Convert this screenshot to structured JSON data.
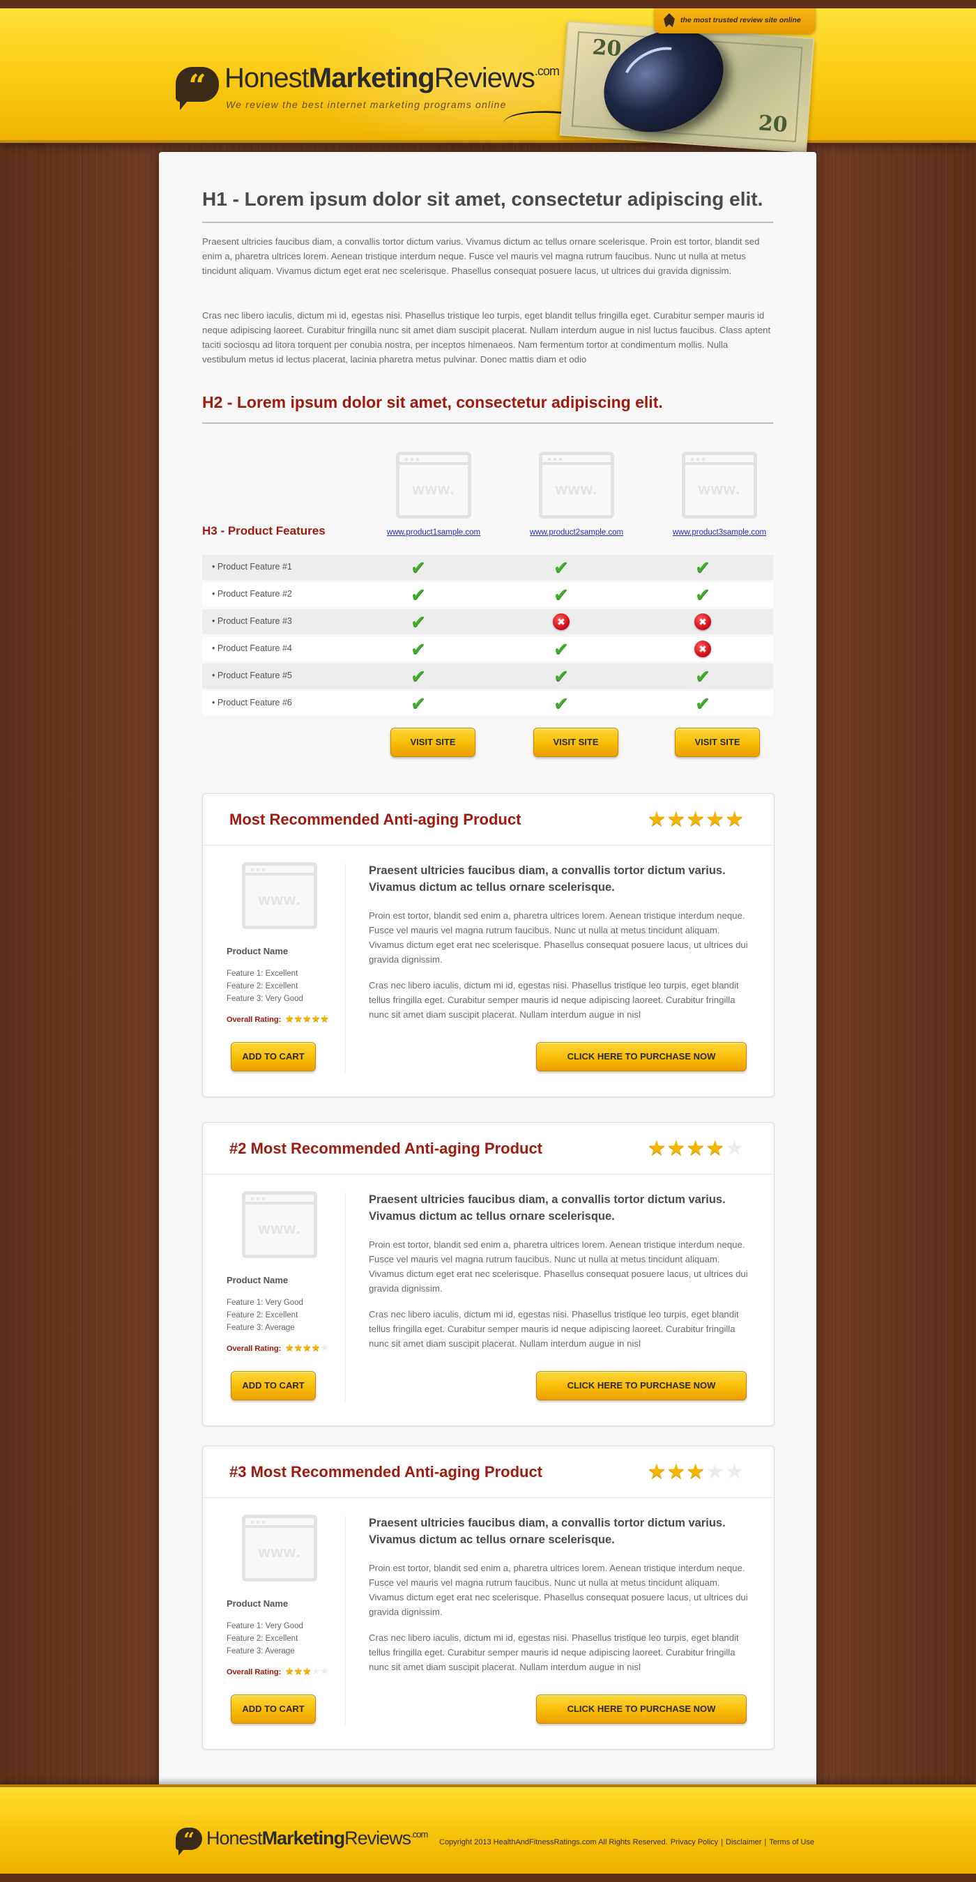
{
  "header": {
    "logo_light": "Honest",
    "logo_bold": "Marketing",
    "logo_light2": "Reviews",
    "logo_sup": ".com",
    "tagline": "We review the best internet marketing programs online",
    "badge": "the most trusted review site online",
    "money_value": "20"
  },
  "intro": {
    "h1": "H1 - Lorem ipsum dolor sit amet, consectetur adipiscing elit.",
    "p1": "Praesent ultricies faucibus diam, a convallis tortor dictum varius. Vivamus dictum ac tellus ornare scelerisque. Proin est tortor, blandit sed enim a, pharetra ultrices lorem. Aenean tristique interdum neque. Fusce vel mauris vel magna rutrum faucibus. Nunc ut nulla at metus tincidunt aliquam. Vivamus dictum eget erat nec scelerisque. Phasellus consequat posuere lacus, ut ultrices dui gravida dignissim.",
    "p2": "Cras nec libero iaculis, dictum mi id, egestas nisi. Phasellus tristique leo turpis, eget blandit tellus fringilla eget. Curabitur semper mauris id neque adipiscing laoreet. Curabitur fringilla nunc sit amet diam suscipit placerat. Nullam interdum augue in nisl luctus faucibus. Class aptent taciti sociosqu ad litora torquent per conubia nostra, per inceptos himenaeos. Nam fermentum tortor at condimentum mollis. Nulla vestibulum metus id lectus placerat, lacinia pharetra metus pulvinar. Donec mattis diam et odio",
    "h2": "H2 - Lorem ipsum dolor sit amet, consectetur adipiscing elit."
  },
  "comparison": {
    "h3": "H3 - Product Features",
    "placeholder_text": "www.",
    "products": [
      {
        "link": "www.product1sample.com",
        "button": "VISIT SITE"
      },
      {
        "link": "www.product2sample.com",
        "button": "VISIT SITE"
      },
      {
        "link": "www.product3sample.com",
        "button": "VISIT SITE"
      }
    ],
    "features": [
      {
        "label": "• Product Feature #1",
        "values": [
          true,
          true,
          true
        ]
      },
      {
        "label": "• Product Feature #2",
        "values": [
          true,
          true,
          true
        ]
      },
      {
        "label": "• Product Feature #3",
        "values": [
          true,
          false,
          false
        ]
      },
      {
        "label": "• Product Feature #4",
        "values": [
          true,
          true,
          false
        ]
      },
      {
        "label": "• Product Feature #5",
        "values": [
          true,
          true,
          true
        ]
      },
      {
        "label": "• Product Feature #6",
        "values": [
          true,
          true,
          true
        ]
      }
    ]
  },
  "cards": [
    {
      "title": "Most Recommended Anti-aging Product",
      "rating": 5,
      "product_name": "Product Name",
      "features": [
        "Feature 1: Excellent",
        "Feature 2: Excellent",
        "Feature 3: Very Good"
      ],
      "rating_label": "Overall Rating:",
      "add_to_cart": "ADD TO CART",
      "lead": "Praesent ultricies faucibus diam, a convallis tortor dictum varius. Vivamus dictum ac tellus ornare scelerisque.",
      "p1": "Proin est tortor, blandit sed enim a, pharetra ultrices lorem. Aenean tristique interdum neque. Fusce vel mauris vel magna rutrum faucibus. Nunc ut nulla at metus tincidunt aliquam. Vivamus dictum eget erat nec scelerisque. Phasellus consequat posuere lacus, ut ultrices dui gravida dignissim.",
      "p2": "Cras nec libero iaculis, dictum mi id, egestas nisi. Phasellus tristique leo turpis, eget blandit tellus fringilla eget. Curabitur semper mauris id neque adipiscing laoreet. Curabitur fringilla nunc sit amet diam suscipit placerat. Nullam interdum augue in nisl",
      "purchase": "CLICK HERE TO PURCHASE NOW"
    },
    {
      "title": "#2 Most Recommended Anti-aging Product",
      "rating": 4,
      "product_name": "Product Name",
      "features": [
        "Feature 1: Very Good",
        "Feature 2: Excellent",
        "Feature 3: Average"
      ],
      "rating_label": "Overall Rating:",
      "add_to_cart": "ADD TO CART",
      "lead": "Praesent ultricies faucibus diam, a convallis tortor dictum varius. Vivamus dictum ac tellus ornare scelerisque.",
      "p1": "Proin est tortor, blandit sed enim a, pharetra ultrices lorem. Aenean tristique interdum neque. Fusce vel mauris vel magna rutrum faucibus. Nunc ut nulla at metus tincidunt aliquam. Vivamus dictum eget erat nec scelerisque. Phasellus consequat posuere lacus, ut ultrices dui gravida dignissim.",
      "p2": "Cras nec libero iaculis, dictum mi id, egestas nisi. Phasellus tristique leo turpis, eget blandit tellus fringilla eget. Curabitur semper mauris id neque adipiscing laoreet. Curabitur fringilla nunc sit amet diam suscipit placerat. Nullam interdum augue in nisl",
      "purchase": "CLICK HERE TO PURCHASE NOW"
    },
    {
      "title": "#3 Most Recommended Anti-aging Product",
      "rating": 3,
      "product_name": "Product Name",
      "features": [
        "Feature 1: Very Good",
        "Feature 2: Excellent",
        "Feature 3: Average"
      ],
      "rating_label": "Overall Rating:",
      "add_to_cart": "ADD TO CART",
      "lead": "Praesent ultricies faucibus diam, a convallis tortor dictum varius. Vivamus dictum ac tellus ornare scelerisque.",
      "p1": "Proin est tortor, blandit sed enim a, pharetra ultrices lorem. Aenean tristique interdum neque. Fusce vel mauris vel magna rutrum faucibus. Nunc ut nulla at metus tincidunt aliquam. Vivamus dictum eget erat nec scelerisque. Phasellus consequat posuere lacus, ut ultrices dui gravida dignissim.",
      "p2": "Cras nec libero iaculis, dictum mi id, egestas nisi. Phasellus tristique leo turpis, eget blandit tellus fringilla eget. Curabitur semper mauris id neque adipiscing laoreet. Curabitur fringilla nunc sit amet diam suscipit placerat. Nullam interdum augue in nisl",
      "purchase": "CLICK HERE TO PURCHASE NOW"
    }
  ],
  "footer": {
    "copyright": "Copyright 2013 HealthAndFitnessRatings.com All Rights Reserved.",
    "links": [
      "Privacy Policy",
      "Disclaimer",
      "Terms of Use"
    ],
    "separator": "|"
  },
  "colors": {
    "accent_red": "#a01a0e",
    "yellow": "#f8c40c",
    "wood": "#6b3a22",
    "check_green": "#3fae29",
    "cross_red": "#d0121b",
    "link_blue": "#1e30c6"
  },
  "icons": {
    "check": "checkmark-icon",
    "cross": "cross-icon",
    "star": "star-icon",
    "logo": "quote-bubble-icon"
  }
}
